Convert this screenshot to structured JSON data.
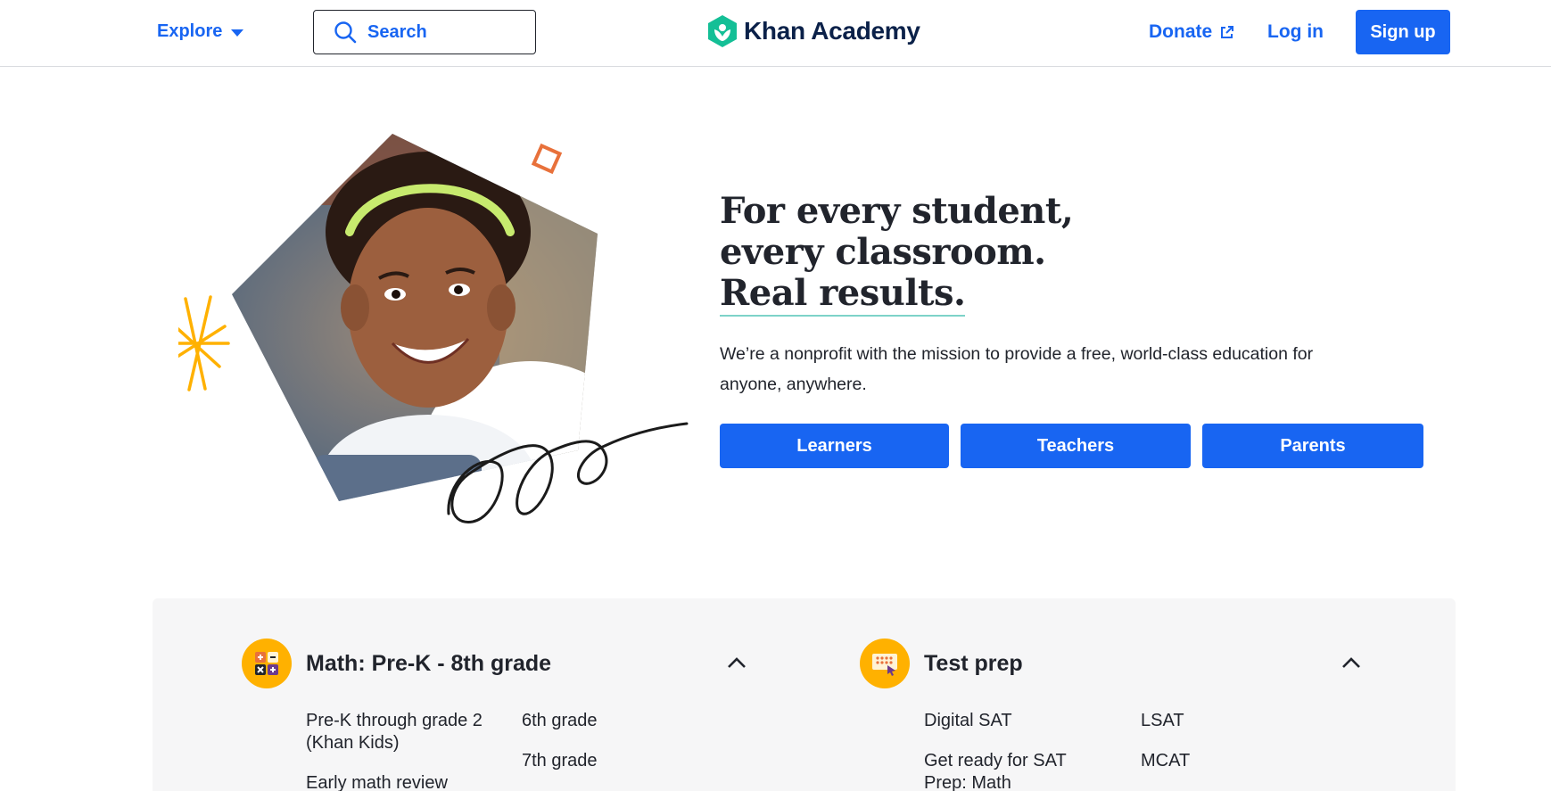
{
  "header": {
    "explore_label": "Explore",
    "search_placeholder": "Search",
    "brand": "Khan Academy",
    "donate_label": "Donate",
    "login_label": "Log in",
    "signup_label": "Sign up"
  },
  "hero": {
    "title_lines": [
      "For every student,",
      "every classroom.",
      "Real results."
    ],
    "subtitle": "We’re a nonprofit with the mission to provide a free, world-class education for anyone, anywhere.",
    "buttons": [
      "Learners",
      "Teachers",
      "Parents"
    ]
  },
  "subjects": [
    {
      "title": "Math: Pre-K - 8th grade",
      "icon": "math-operations-icon",
      "links_col1": [
        "Pre-K through grade 2 (Khan Kids)",
        "Early math review"
      ],
      "links_col2": [
        "6th grade",
        "7th grade"
      ]
    },
    {
      "title": "Test prep",
      "icon": "test-prep-icon",
      "links_col1": [
        "Digital SAT",
        "Get ready for SAT Prep: Math"
      ],
      "links_col2": [
        "LSAT",
        "MCAT"
      ]
    }
  ],
  "colors": {
    "brand_blue": "#1865f2",
    "brand_green": "#14bf96",
    "subject_icon_bg": "#ffb100",
    "panel_bg": "#f6f6f7"
  }
}
